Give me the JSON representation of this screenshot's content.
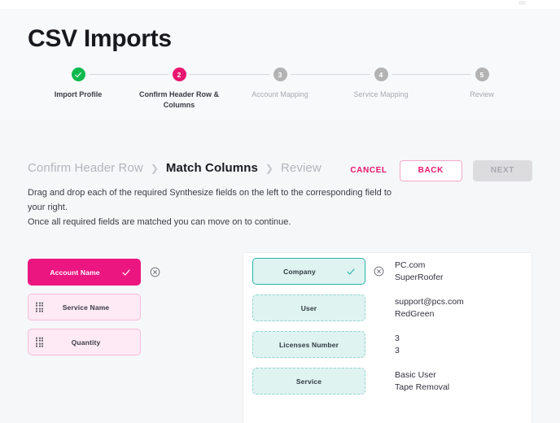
{
  "page": {
    "title": "CSV Imports"
  },
  "stepper": {
    "steps": [
      {
        "number": "1",
        "label": "Import Profile",
        "state": "done"
      },
      {
        "number": "2",
        "label": "Confirm Header Row & Columns",
        "state": "active"
      },
      {
        "number": "3",
        "label": "Account Mapping",
        "state": "todo"
      },
      {
        "number": "4",
        "label": "Service Mapping",
        "state": "todo"
      },
      {
        "number": "5",
        "label": "Review",
        "state": "todo"
      }
    ]
  },
  "breadcrumb": {
    "items": [
      {
        "label": "Confirm Header Row",
        "current": false
      },
      {
        "label": "Match Columns",
        "current": true
      },
      {
        "label": "Review",
        "current": false
      }
    ],
    "separator": "❯"
  },
  "actions": {
    "cancel_label": "CANCEL",
    "back_label": "BACK",
    "next_label": "NEXT"
  },
  "instructions": {
    "line1": "Drag and drop each of the required Synthesize fields on the left to the corresponding field to your right.",
    "line2": "Once all required fields are matched you can move on to continue."
  },
  "source_fields": [
    {
      "label": "Account Name",
      "matched": true
    },
    {
      "label": "Service Name",
      "matched": false
    },
    {
      "label": "Quantity",
      "matched": false
    }
  ],
  "target_fields": [
    {
      "label": "Company",
      "filled": true,
      "values": [
        "PC.com",
        "SuperRoofer"
      ]
    },
    {
      "label": "User",
      "filled": false,
      "values": [
        "support@pcs.com",
        "RedGreen"
      ]
    },
    {
      "label": "Licenses Number",
      "filled": false,
      "values": [
        "3",
        "3"
      ]
    },
    {
      "label": "Service",
      "filled": false,
      "values": [
        "Basic User",
        "Tape Removal"
      ]
    }
  ],
  "colors": {
    "accent_pink": "#ec1681",
    "accent_teal": "#2ab5ab",
    "success_green": "#0fb94f",
    "step_inactive": "#b3b3b3",
    "page_background": "#f6f7f8"
  },
  "icons": {
    "check": "check-icon",
    "remove": "circle-x-icon",
    "drag": "drag-handle-icon"
  }
}
